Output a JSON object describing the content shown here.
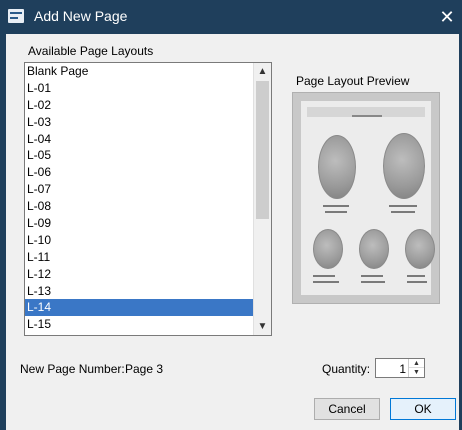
{
  "window": {
    "title": "Add New Page",
    "close_glyph": "✕"
  },
  "layouts": {
    "label": "Available Page Layouts",
    "items": [
      "Blank Page",
      "L-01",
      "L-02",
      "L-03",
      "L-04",
      "L-05",
      "L-06",
      "L-07",
      "L-08",
      "L-09",
      "L-10",
      "L-11",
      "L-12",
      "L-13",
      "L-14",
      "L-15"
    ],
    "selected": "L-14",
    "scroll_up_glyph": "▲",
    "scroll_down_glyph": "▼"
  },
  "preview": {
    "label": "Page Layout Preview"
  },
  "page_number": {
    "label": "New Page Number:",
    "value": "Page 3"
  },
  "quantity": {
    "label": "Quantity:",
    "value": "1",
    "up_glyph": "▲",
    "down_glyph": "▼"
  },
  "buttons": {
    "cancel": "Cancel",
    "ok": "OK"
  },
  "colors": {
    "titlebar": "#1f3f5c",
    "selection": "#3a77c6"
  },
  "icons": {
    "app": "app-icon",
    "close": "close-icon"
  }
}
